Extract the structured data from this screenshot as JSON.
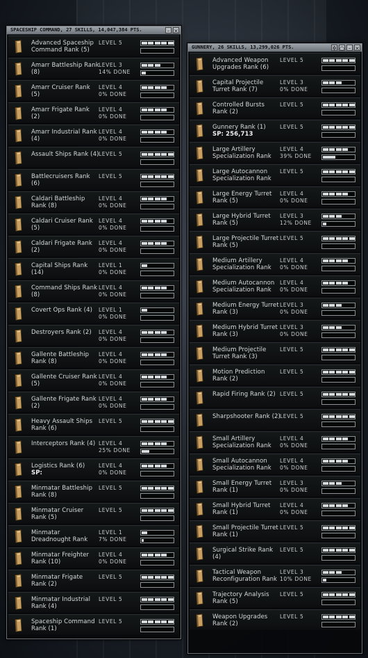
{
  "colors": {
    "window_bg": "#06080a",
    "titlebar": "#8a9096",
    "text": "#d8dcdf",
    "bar_fill": "#d9dcdf"
  },
  "icons": {
    "skill": "skillbook-icon",
    "close": "close-icon",
    "minimize": "minimize-icon",
    "pin": "pin-icon"
  },
  "spaceship_window": {
    "title": "SPACESHIP COMMAND, 27 SKILLS, 14,047,384 PTS.",
    "skills": [
      {
        "name": "Advanced Spaceship Command Rank (5)",
        "level": 5,
        "level_label": "LEVEL 5",
        "done": "",
        "progress": 0
      },
      {
        "name": "Amarr Battleship Rank (8)",
        "level": 3,
        "level_label": "LEVEL 3",
        "done": "14% DONE",
        "progress": 0.14
      },
      {
        "name": "Amarr Cruiser Rank (5)",
        "level": 4,
        "level_label": "LEVEL 4",
        "done": "0% DONE",
        "progress": 0
      },
      {
        "name": "Amarr Frigate Rank (2)",
        "level": 4,
        "level_label": "LEVEL 4",
        "done": "0% DONE",
        "progress": 0
      },
      {
        "name": "Amarr Industrial Rank (4)",
        "level": 4,
        "level_label": "LEVEL 4",
        "done": "0% DONE",
        "progress": 0
      },
      {
        "name": "Assault Ships Rank (4)",
        "level": 5,
        "level_label": "LEVEL 5",
        "done": "",
        "progress": 0
      },
      {
        "name": "Battlecruisers Rank (6)",
        "level": 5,
        "level_label": "LEVEL 5",
        "done": "",
        "progress": 0
      },
      {
        "name": "Caldari Battleship Rank (8)",
        "level": 4,
        "level_label": "LEVEL 4",
        "done": "0% DONE",
        "progress": 0
      },
      {
        "name": "Caldari Cruiser Rank (5)",
        "level": 4,
        "level_label": "LEVEL 4",
        "done": "0% DONE",
        "progress": 0
      },
      {
        "name": "Caldari Frigate Rank (2)",
        "level": 4,
        "level_label": "LEVEL 4",
        "done": "0% DONE",
        "progress": 0
      },
      {
        "name": "Capital Ships Rank (14)",
        "level": 1,
        "level_label": "LEVEL 1",
        "done": "0% DONE",
        "progress": 0
      },
      {
        "name": "Command Ships Rank (8)",
        "level": 4,
        "level_label": "LEVEL 4",
        "done": "0% DONE",
        "progress": 0
      },
      {
        "name": "Covert Ops Rank (4)",
        "level": 1,
        "level_label": "LEVEL 1",
        "done": "0% DONE",
        "progress": 0
      },
      {
        "name": "Destroyers Rank (2)",
        "level": 4,
        "level_label": "LEVEL 4",
        "done": "0% DONE",
        "progress": 0
      },
      {
        "name": "Gallente Battleship Rank (8)",
        "level": 4,
        "level_label": "LEVEL 4",
        "done": "0% DONE",
        "progress": 0
      },
      {
        "name": "Gallente Cruiser Rank (5)",
        "level": 4,
        "level_label": "LEVEL 4",
        "done": "0% DONE",
        "progress": 0
      },
      {
        "name": "Gallente Frigate Rank (2)",
        "level": 4,
        "level_label": "LEVEL 4",
        "done": "0% DONE",
        "progress": 0
      },
      {
        "name": "Heavy Assault Ships Rank (6)",
        "level": 5,
        "level_label": "LEVEL 5",
        "done": "",
        "progress": 0
      },
      {
        "name": "Interceptors Rank (4)",
        "level": 4,
        "level_label": "LEVEL 4",
        "done": "25% DONE",
        "progress": 0.25
      },
      {
        "name": "Logistics Rank (6)",
        "sp": "SP:",
        "level": 4,
        "level_label": "LEVEL 4",
        "done": "0% DONE",
        "progress": 0
      },
      {
        "name": "Minmatar Battleship Rank (8)",
        "level": 5,
        "level_label": "LEVEL 5",
        "done": "",
        "progress": 0
      },
      {
        "name": "Minmatar Cruiser Rank (5)",
        "level": 5,
        "level_label": "LEVEL 5",
        "done": "",
        "progress": 0
      },
      {
        "name": "Minmatar Dreadnought Rank",
        "level": 1,
        "level_label": "LEVEL 1",
        "done": "7% DONE",
        "progress": 0.07
      },
      {
        "name": "Minmatar Freighter Rank (10)",
        "level": 4,
        "level_label": "LEVEL 4",
        "done": "0% DONE",
        "progress": 0
      },
      {
        "name": "Minmatar Frigate Rank (2)",
        "level": 5,
        "level_label": "LEVEL 5",
        "done": "",
        "progress": 0
      },
      {
        "name": "Minmatar Industrial Rank (4)",
        "level": 5,
        "level_label": "LEVEL 5",
        "done": "",
        "progress": 0
      },
      {
        "name": "Spaceship Command Rank (1)",
        "level": 5,
        "level_label": "LEVEL 5",
        "done": "",
        "progress": 0
      }
    ]
  },
  "gunnery_window": {
    "title": "GUNNERY, 26 SKILLS, 13,299,026 PTS.",
    "skills": [
      {
        "name": "Advanced Weapon Upgrades Rank (6)",
        "level": 5,
        "level_label": "LEVEL 5",
        "done": "",
        "progress": 0
      },
      {
        "name": "Capital Projectile Turret Rank (7)",
        "level": 3,
        "level_label": "LEVEL 3",
        "done": "0% DONE",
        "progress": 0
      },
      {
        "name": "Controlled Bursts Rank (2)",
        "level": 5,
        "level_label": "LEVEL 5",
        "done": "",
        "progress": 0
      },
      {
        "name": "Gunnery Rank (1)",
        "sp": "SP: 256,713",
        "level": 5,
        "level_label": "LEVEL 5",
        "done": "",
        "progress": 0
      },
      {
        "name": "Large Artillery Specialization Rank",
        "level": 4,
        "level_label": "LEVEL 4",
        "done": "39% DONE",
        "progress": 0.39
      },
      {
        "name": "Large Autocannon Specialization Rank",
        "level": 5,
        "level_label": "LEVEL 5",
        "done": "",
        "progress": 0
      },
      {
        "name": "Large Energy Turret Rank (5)",
        "level": 4,
        "level_label": "LEVEL 4",
        "done": "0% DONE",
        "progress": 0
      },
      {
        "name": "Large Hybrid Turret Rank (5)",
        "level": 3,
        "level_label": "LEVEL 3",
        "done": "12% DONE",
        "progress": 0.12
      },
      {
        "name": "Large Projectile Turret Rank (5)",
        "level": 5,
        "level_label": "LEVEL 5",
        "done": "",
        "progress": 0
      },
      {
        "name": "Medium Artillery Specialization Rank",
        "level": 4,
        "level_label": "LEVEL 4",
        "done": "0% DONE",
        "progress": 0
      },
      {
        "name": "Medium Autocannon Specialization Rank",
        "level": 4,
        "level_label": "LEVEL 4",
        "done": "0% DONE",
        "progress": 0
      },
      {
        "name": "Medium Energy Turret Rank (3)",
        "level": 3,
        "level_label": "LEVEL 3",
        "done": "0% DONE",
        "progress": 0
      },
      {
        "name": "Medium Hybrid Turret Rank (3)",
        "level": 3,
        "level_label": "LEVEL 3",
        "done": "0% DONE",
        "progress": 0
      },
      {
        "name": "Medium Projectile Turret Rank (3)",
        "level": 5,
        "level_label": "LEVEL 5",
        "done": "",
        "progress": 0
      },
      {
        "name": "Motion Prediction Rank (2)",
        "level": 5,
        "level_label": "LEVEL 5",
        "done": "",
        "progress": 0
      },
      {
        "name": "Rapid Firing Rank (2)",
        "level": 5,
        "level_label": "LEVEL 5",
        "done": "",
        "progress": 0
      },
      {
        "name": "Sharpshooter Rank (2)",
        "level": 5,
        "level_label": "LEVEL 5",
        "done": "",
        "progress": 0
      },
      {
        "name": "Small Artillery Specialization Rank",
        "level": 4,
        "level_label": "LEVEL 4",
        "done": "0% DONE",
        "progress": 0
      },
      {
        "name": "Small Autocannon Specialization Rank",
        "level": 4,
        "level_label": "LEVEL 4",
        "done": "0% DONE",
        "progress": 0
      },
      {
        "name": "Small Energy Turret Rank (1)",
        "level": 3,
        "level_label": "LEVEL 3",
        "done": "0% DONE",
        "progress": 0
      },
      {
        "name": "Small Hybrid Turret Rank (1)",
        "level": 4,
        "level_label": "LEVEL 4",
        "done": "0% DONE",
        "progress": 0
      },
      {
        "name": "Small Projectile Turret Rank (1)",
        "level": 5,
        "level_label": "LEVEL 5",
        "done": "",
        "progress": 0
      },
      {
        "name": "Surgical Strike Rank (4)",
        "level": 5,
        "level_label": "LEVEL 5",
        "done": "",
        "progress": 0
      },
      {
        "name": "Tactical Weapon Reconfiguration Rank",
        "level": 3,
        "level_label": "LEVEL 3",
        "done": "10% DONE",
        "progress": 0.1
      },
      {
        "name": "Trajectory Analysis Rank (5)",
        "level": 5,
        "level_label": "LEVEL 5",
        "done": "",
        "progress": 0
      },
      {
        "name": "Weapon Upgrades Rank (2)",
        "level": 5,
        "level_label": "LEVEL 5",
        "done": "",
        "progress": 0
      }
    ]
  }
}
